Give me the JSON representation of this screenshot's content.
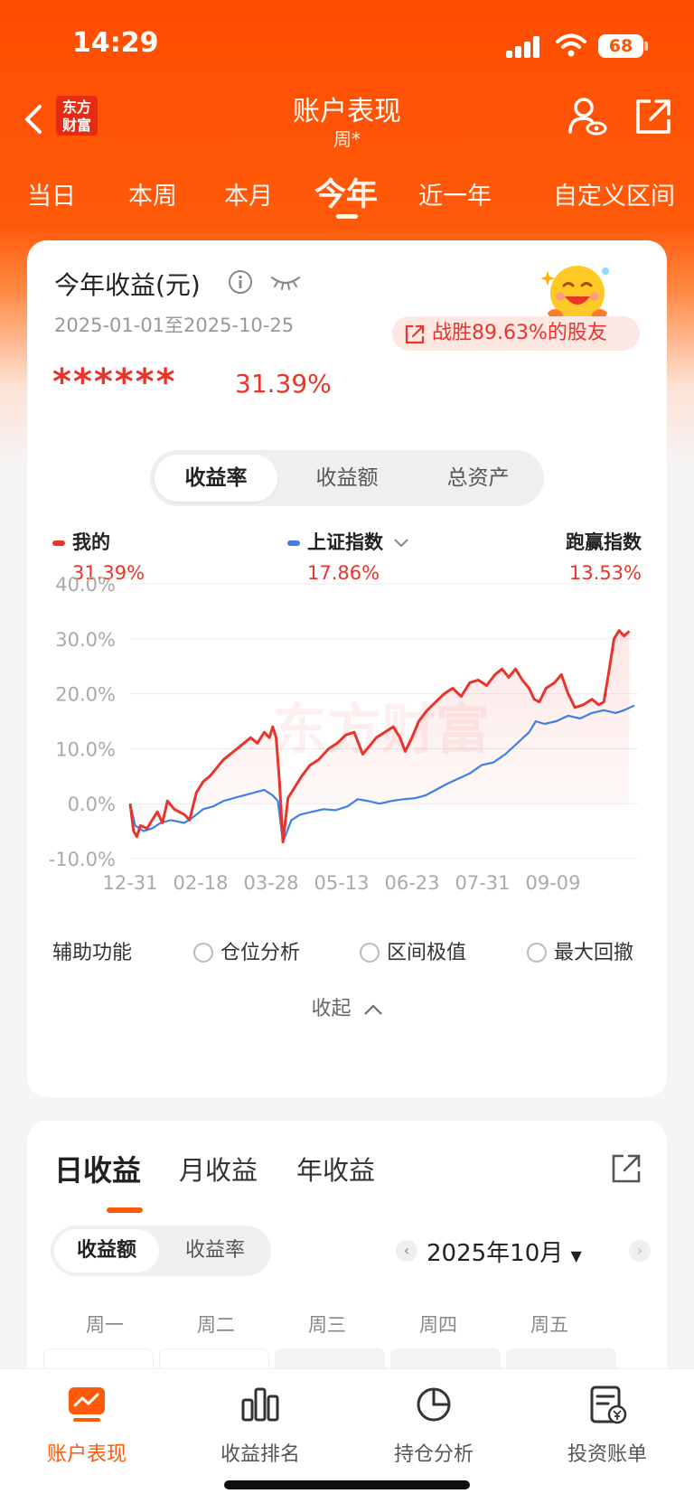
{
  "status_bar": {
    "time": "14:29",
    "battery": "68"
  },
  "nav": {
    "logo_line1": "东方",
    "logo_line2": "财富",
    "title": "账户表现",
    "subtitle": "周*"
  },
  "period_tabs": [
    {
      "label": "当日"
    },
    {
      "label": "本周"
    },
    {
      "label": "本月"
    },
    {
      "label": "今年",
      "active": true
    },
    {
      "label": "近一年"
    },
    {
      "label": "自定义区间"
    }
  ],
  "summary": {
    "title": "今年收益(元)",
    "date_range": "2025-01-01至2025-10-25",
    "beat_text": "战胜89.63%的股友",
    "masked_amount": "******",
    "return_pct": "31.39%"
  },
  "metric_tabs": [
    {
      "label": "收益率",
      "active": true
    },
    {
      "label": "收益额"
    },
    {
      "label": "总资产"
    }
  ],
  "legend": {
    "mine": {
      "name": "我的",
      "value": "31.39%",
      "color": "#e8342b"
    },
    "index": {
      "name": "上证指数",
      "value": "17.86%",
      "color": "#3f7fe6"
    },
    "excess": {
      "name": "跑赢指数",
      "value": "13.53%"
    }
  },
  "chart_data": {
    "type": "line",
    "watermark": "东方财富",
    "ylim": [
      -10,
      40
    ],
    "yticks": [
      "40.0%",
      "30.0%",
      "20.0%",
      "10.0%",
      "0.0%",
      "-10.0%"
    ],
    "xticks": [
      "12-31",
      "02-18",
      "03-28",
      "05-13",
      "06-23",
      "07-31",
      "09-09"
    ],
    "x_range": [
      "2024-12-31",
      "2025-10-24"
    ],
    "series": [
      {
        "name": "我的",
        "color": "#e8342b",
        "points": [
          [
            "2024-12-31",
            0
          ],
          [
            "2025-01-02",
            -5
          ],
          [
            "2025-01-04",
            -6
          ],
          [
            "2025-01-06",
            -4
          ],
          [
            "2025-01-10",
            -4.5
          ],
          [
            "2025-01-13",
            -3
          ],
          [
            "2025-01-16",
            -1.5
          ],
          [
            "2025-01-19",
            -3.5
          ],
          [
            "2025-01-22",
            0.5
          ],
          [
            "2025-01-26",
            -1
          ],
          [
            "2025-02-01",
            -2
          ],
          [
            "2025-02-04",
            -3
          ],
          [
            "2025-02-08",
            2
          ],
          [
            "2025-02-12",
            4
          ],
          [
            "2025-02-16",
            5
          ],
          [
            "2025-02-20",
            6.5
          ],
          [
            "2025-02-24",
            8
          ],
          [
            "2025-02-28",
            9
          ],
          [
            "2025-03-04",
            10
          ],
          [
            "2025-03-08",
            11
          ],
          [
            "2025-03-12",
            12
          ],
          [
            "2025-03-16",
            11
          ],
          [
            "2025-03-20",
            13
          ],
          [
            "2025-03-23",
            12
          ],
          [
            "2025-03-25",
            14
          ],
          [
            "2025-03-27",
            12
          ],
          [
            "2025-03-29",
            4
          ],
          [
            "2025-03-31",
            -7
          ],
          [
            "2025-04-03",
            1
          ],
          [
            "2025-04-07",
            3
          ],
          [
            "2025-04-11",
            5
          ],
          [
            "2025-04-16",
            7
          ],
          [
            "2025-04-21",
            8
          ],
          [
            "2025-04-27",
            10
          ],
          [
            "2025-05-02",
            11
          ],
          [
            "2025-05-07",
            12.5
          ],
          [
            "2025-05-12",
            13
          ],
          [
            "2025-05-17",
            9
          ],
          [
            "2025-05-21",
            10.5
          ],
          [
            "2025-05-25",
            12
          ],
          [
            "2025-05-30",
            13
          ],
          [
            "2025-06-04",
            14
          ],
          [
            "2025-06-08",
            12
          ],
          [
            "2025-06-11",
            9.5
          ],
          [
            "2025-06-15",
            12
          ],
          [
            "2025-06-19",
            15
          ],
          [
            "2025-06-24",
            17
          ],
          [
            "2025-06-29",
            18.5
          ],
          [
            "2025-07-04",
            20
          ],
          [
            "2025-07-09",
            21
          ],
          [
            "2025-07-14",
            19.5
          ],
          [
            "2025-07-19",
            22
          ],
          [
            "2025-07-24",
            22.5
          ],
          [
            "2025-07-29",
            21.5
          ],
          [
            "2025-08-03",
            23.5
          ],
          [
            "2025-08-07",
            24.5
          ],
          [
            "2025-08-11",
            23
          ],
          [
            "2025-08-15",
            24.5
          ],
          [
            "2025-08-19",
            22.5
          ],
          [
            "2025-08-23",
            21
          ],
          [
            "2025-08-26",
            19
          ],
          [
            "2025-08-29",
            18.5
          ],
          [
            "2025-09-02",
            21
          ],
          [
            "2025-09-07",
            22
          ],
          [
            "2025-09-11",
            23.5
          ],
          [
            "2025-09-15",
            20
          ],
          [
            "2025-09-19",
            17.5
          ],
          [
            "2025-09-24",
            18
          ],
          [
            "2025-09-29",
            19
          ],
          [
            "2025-10-03",
            18
          ],
          [
            "2025-10-06",
            18.5
          ],
          [
            "2025-10-09",
            24
          ],
          [
            "2025-10-12",
            30
          ],
          [
            "2025-10-15",
            31.5
          ],
          [
            "2025-10-18",
            30.5
          ],
          [
            "2025-10-21",
            31.39
          ]
        ]
      },
      {
        "name": "上证指数",
        "color": "#3f7fe6",
        "points": [
          [
            "2024-12-31",
            0
          ],
          [
            "2025-01-03",
            -4
          ],
          [
            "2025-01-08",
            -5
          ],
          [
            "2025-01-13",
            -4.5
          ],
          [
            "2025-01-18",
            -3.5
          ],
          [
            "2025-01-24",
            -3
          ],
          [
            "2025-02-01",
            -3.5
          ],
          [
            "2025-02-06",
            -2.5
          ],
          [
            "2025-02-12",
            -1
          ],
          [
            "2025-02-18",
            -0.5
          ],
          [
            "2025-02-24",
            0.5
          ],
          [
            "2025-03-02",
            1
          ],
          [
            "2025-03-08",
            1.5
          ],
          [
            "2025-03-14",
            2
          ],
          [
            "2025-03-20",
            2.5
          ],
          [
            "2025-03-25",
            1.5
          ],
          [
            "2025-03-28",
            0.5
          ],
          [
            "2025-03-31",
            -7
          ],
          [
            "2025-04-05",
            -3
          ],
          [
            "2025-04-10",
            -2
          ],
          [
            "2025-04-17",
            -1.5
          ],
          [
            "2025-04-24",
            -1
          ],
          [
            "2025-05-01",
            -1.2
          ],
          [
            "2025-05-08",
            -0.5
          ],
          [
            "2025-05-14",
            0.8
          ],
          [
            "2025-05-20",
            0.5
          ],
          [
            "2025-05-27",
            0
          ],
          [
            "2025-06-03",
            0.5
          ],
          [
            "2025-06-10",
            0.8
          ],
          [
            "2025-06-17",
            1
          ],
          [
            "2025-06-23",
            1.5
          ],
          [
            "2025-06-29",
            2.5
          ],
          [
            "2025-07-05",
            3.5
          ],
          [
            "2025-07-12",
            4.5
          ],
          [
            "2025-07-19",
            5.5
          ],
          [
            "2025-07-26",
            7
          ],
          [
            "2025-08-02",
            7.5
          ],
          [
            "2025-08-09",
            9
          ],
          [
            "2025-08-16",
            11
          ],
          [
            "2025-08-23",
            13
          ],
          [
            "2025-08-27",
            15
          ],
          [
            "2025-09-01",
            14.5
          ],
          [
            "2025-09-08",
            15
          ],
          [
            "2025-09-15",
            16
          ],
          [
            "2025-09-22",
            15.5
          ],
          [
            "2025-09-29",
            16.5
          ],
          [
            "2025-10-06",
            17
          ],
          [
            "2025-10-13",
            16.5
          ],
          [
            "2025-10-18",
            17
          ],
          [
            "2025-10-24",
            17.86
          ]
        ]
      }
    ]
  },
  "aux": {
    "label": "辅助功能",
    "options": [
      {
        "label": "仓位分析"
      },
      {
        "label": "区间极值"
      },
      {
        "label": "最大回撤"
      }
    ]
  },
  "collapse_label": "收起",
  "daily": {
    "tabs": [
      {
        "label": "日收益",
        "active": true
      },
      {
        "label": "月收益"
      },
      {
        "label": "年收益"
      }
    ],
    "toggle": [
      {
        "label": "收益额",
        "active": true
      },
      {
        "label": "收益率"
      }
    ],
    "month": "2025年10月",
    "weekdays": [
      "周一",
      "周二",
      "周三",
      "周四",
      "周五"
    ]
  },
  "bottom_nav": [
    {
      "label": "账户表现",
      "icon": "chart-screen-icon",
      "active": true
    },
    {
      "label": "收益排名",
      "icon": "bar-chart-icon"
    },
    {
      "label": "持仓分析",
      "icon": "pie-chart-icon"
    },
    {
      "label": "投资账单",
      "icon": "bill-icon"
    }
  ]
}
